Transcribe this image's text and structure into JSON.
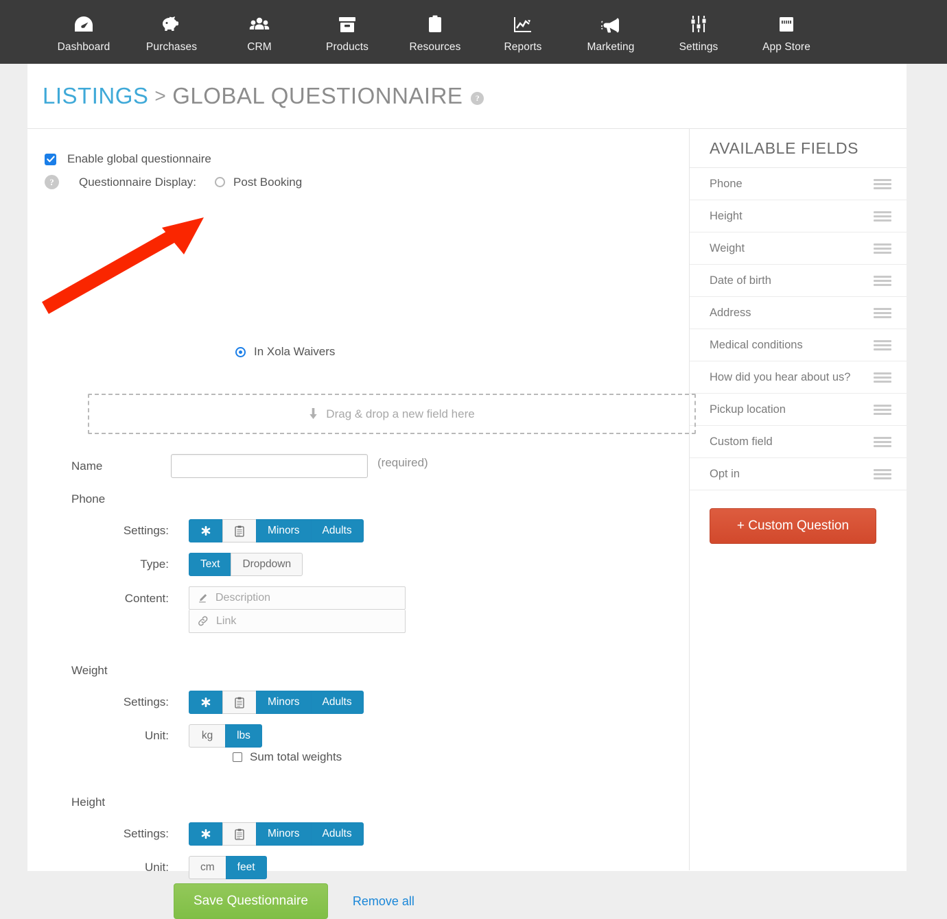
{
  "topnav": {
    "items": [
      {
        "label": "Dashboard",
        "icon": "gauge-icon"
      },
      {
        "label": "Purchases",
        "icon": "piggy-bank-icon"
      },
      {
        "label": "CRM",
        "icon": "people-group-icon"
      },
      {
        "label": "Products",
        "icon": "box-icon"
      },
      {
        "label": "Resources",
        "icon": "clipboard-icon"
      },
      {
        "label": "Reports",
        "icon": "line-chart-icon"
      },
      {
        "label": "Marketing",
        "icon": "megaphone-icon"
      },
      {
        "label": "Settings",
        "icon": "sliders-icon"
      },
      {
        "label": "App Store",
        "icon": "storefront-icon"
      }
    ]
  },
  "breadcrumb": {
    "root": "LISTINGS",
    "separator": ">",
    "current": "GLOBAL QUESTIONNAIRE",
    "help": "?"
  },
  "form": {
    "enable_checkbox_label": "Enable global questionnaire",
    "enable_checkbox_checked": true,
    "display_help": "?",
    "display_label": "Questionnaire Display:",
    "display_options": [
      {
        "label": "Post Booking",
        "selected": false
      },
      {
        "label": "In Xola Waivers",
        "selected": true
      }
    ],
    "dropzone_text": "Drag & drop a new field here",
    "name": {
      "label": "Name",
      "value": "",
      "required_note": "(required)"
    },
    "sections": [
      {
        "title": "Phone",
        "settings_label": "Settings:",
        "settings": [
          {
            "label": "",
            "icon": "asterisk-icon",
            "active": true
          },
          {
            "label": "",
            "icon": "clipboard-icon",
            "active": false
          },
          {
            "label": "Minors",
            "icon": "",
            "active": true
          },
          {
            "label": "Adults",
            "icon": "",
            "active": true
          }
        ],
        "type_label": "Type:",
        "type_options": [
          {
            "label": "Text",
            "active": true
          },
          {
            "label": "Dropdown",
            "active": false
          }
        ],
        "content_label": "Content:",
        "content_inputs": [
          {
            "placeholder": "Description",
            "icon": "pencil-icon",
            "value": ""
          },
          {
            "placeholder": "Link",
            "icon": "link-icon",
            "value": ""
          }
        ]
      },
      {
        "title": "Weight",
        "settings_label": "Settings:",
        "settings": [
          {
            "label": "",
            "icon": "asterisk-icon",
            "active": true
          },
          {
            "label": "",
            "icon": "clipboard-icon",
            "active": false
          },
          {
            "label": "Minors",
            "icon": "",
            "active": true
          },
          {
            "label": "Adults",
            "icon": "",
            "active": true
          }
        ],
        "unit_label": "Unit:",
        "unit_options": [
          {
            "label": "kg",
            "active": false
          },
          {
            "label": "lbs",
            "active": true
          }
        ],
        "sum_label": "Sum total weights",
        "sum_checked": false
      },
      {
        "title": "Height",
        "settings_label": "Settings:",
        "settings": [
          {
            "label": "",
            "icon": "asterisk-icon",
            "active": true
          },
          {
            "label": "",
            "icon": "clipboard-icon",
            "active": false
          },
          {
            "label": "Minors",
            "icon": "",
            "active": true
          },
          {
            "label": "Adults",
            "icon": "",
            "active": true
          }
        ],
        "unit_label": "Unit:",
        "unit_options": [
          {
            "label": "cm",
            "active": false
          },
          {
            "label": "feet",
            "active": true
          }
        ]
      }
    ],
    "save_label": "Save Questionnaire",
    "remove_all_label": "Remove all"
  },
  "available_fields": {
    "title": "AVAILABLE FIELDS",
    "items": [
      "Phone",
      "Height",
      "Weight",
      "Date of birth",
      "Address",
      "Medical conditions",
      "How did you hear about us?",
      "Pickup location",
      "Custom field",
      "Opt in"
    ],
    "custom_question_label": "+ Custom Question"
  },
  "annotation": {
    "type": "arrow",
    "color": "#fa2600",
    "points_to": "in-xola-waivers-radio"
  },
  "colors": {
    "nav_bg": "#3b3b3b",
    "accent_blue": "#1b8bbd",
    "link_blue": "#3fa9d8",
    "checkbox_blue": "#1a7ee8",
    "save_green": "#86c council",
    "custom_question_red": "#d2492c",
    "annotation_red": "#fa2600",
    "page_bg": "#eeeeee"
  }
}
